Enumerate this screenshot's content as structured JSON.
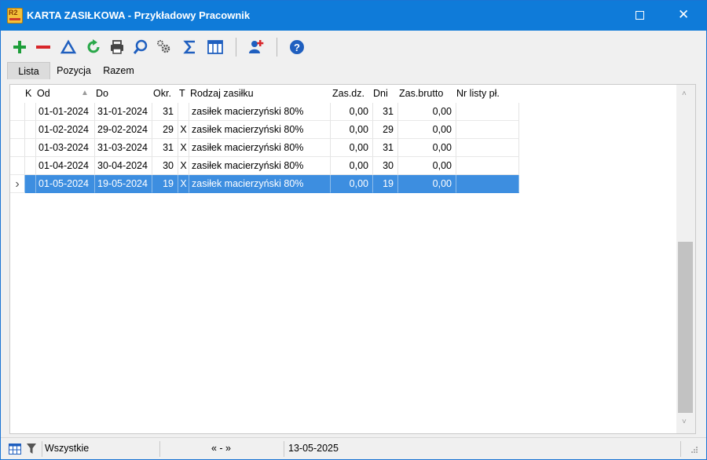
{
  "window": {
    "title": "KARTA ZASIŁKOWA - Przykładowy Pracownik",
    "app_icon_text": "R2",
    "controls": {
      "maximize_icon": "maximize-icon",
      "close_icon": "close-icon",
      "close_glyph": "✕"
    }
  },
  "toolbar": {
    "items": [
      {
        "name": "add-icon",
        "color": "#1e9e3a"
      },
      {
        "name": "remove-icon",
        "color": "#d8262a"
      },
      {
        "name": "edit-triangle-icon",
        "color": "#1f5fbf"
      },
      {
        "name": "refresh-icon",
        "color": "#2aa84a"
      },
      {
        "name": "print-icon",
        "color": "#444444"
      },
      {
        "name": "search-icon",
        "color": "#1f5fbf"
      },
      {
        "name": "settings-icon",
        "color": "#555555"
      },
      {
        "name": "sum-icon",
        "color": "#1f5fbf"
      },
      {
        "name": "columns-icon",
        "color": "#1f5fbf"
      },
      {
        "name": "add-person-icon",
        "color": "#1f5fbf"
      },
      {
        "name": "help-icon",
        "color": "#1f5fbf"
      }
    ]
  },
  "tabs": [
    {
      "label": "Lista",
      "active": true
    },
    {
      "label": "Pozycja",
      "active": false
    },
    {
      "label": "Razem",
      "active": false
    }
  ],
  "grid": {
    "columns": [
      "K",
      "Od",
      "▲",
      "Do",
      "Okr.",
      "T",
      "Rodzaj zasiłku",
      "Zas.dz.",
      "Dni",
      "Zas.brutto",
      "Nr listy pł."
    ],
    "rows": [
      {
        "k": "",
        "od": "01-01-2024",
        "do": "31-01-2024",
        "okr": "31",
        "t": "",
        "rodzaj": "zasiłek macierzyński 80%",
        "zasdz": "0,00",
        "dni": "31",
        "brutto": "0,00",
        "nr": ""
      },
      {
        "k": "",
        "od": "01-02-2024",
        "do": "29-02-2024",
        "okr": "29",
        "t": "X",
        "rodzaj": "zasiłek macierzyński 80%",
        "zasdz": "0,00",
        "dni": "29",
        "brutto": "0,00",
        "nr": ""
      },
      {
        "k": "",
        "od": "01-03-2024",
        "do": "31-03-2024",
        "okr": "31",
        "t": "X",
        "rodzaj": "zasiłek macierzyński 80%",
        "zasdz": "0,00",
        "dni": "31",
        "brutto": "0,00",
        "nr": ""
      },
      {
        "k": "",
        "od": "01-04-2024",
        "do": "30-04-2024",
        "okr": "30",
        "t": "X",
        "rodzaj": "zasiłek macierzyński 80%",
        "zasdz": "0,00",
        "dni": "30",
        "brutto": "0,00",
        "nr": ""
      },
      {
        "k": "",
        "od": "01-05-2024",
        "do": "19-05-2024",
        "okr": "19",
        "t": "X",
        "rodzaj": "zasiłek macierzyński 80%",
        "zasdz": "0,00",
        "dni": "19",
        "brutto": "0,00",
        "nr": "",
        "selected": true
      }
    ],
    "row_indicator": "›",
    "selection_color": "#3d8ee0"
  },
  "scrollbar": {
    "up_glyph": "˄",
    "down_glyph": "˅"
  },
  "status": {
    "filter_label": "Wszystkie",
    "nav_label": "« - »",
    "date": "13-05-2025"
  }
}
